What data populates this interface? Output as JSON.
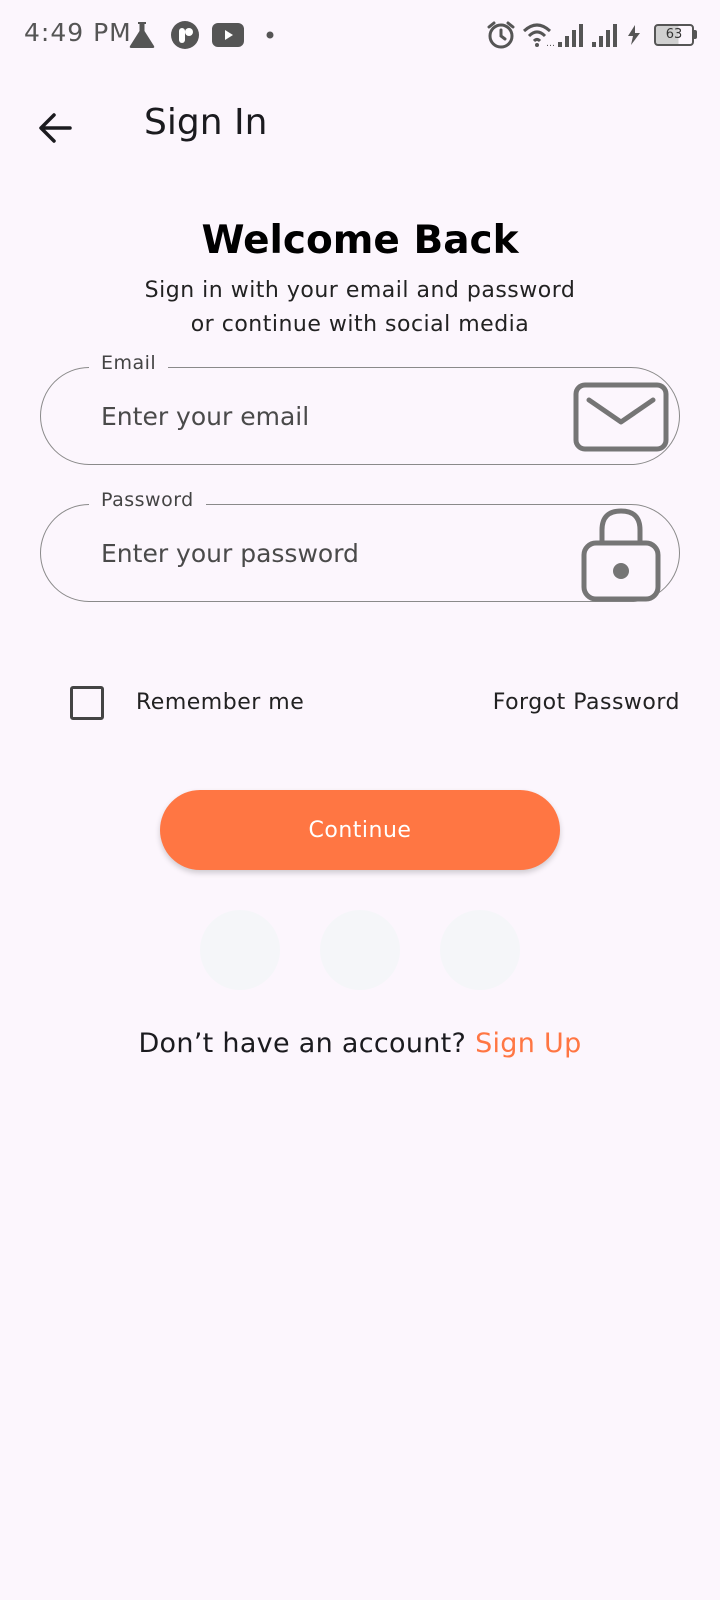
{
  "status_bar": {
    "time": "4:49 PM",
    "battery_level": "63",
    "icons": [
      "flask-icon",
      "app-badge-icon",
      "youtube-icon",
      "dot-icon",
      "alarm-icon",
      "wifi-icon",
      "signal-icon",
      "signal-icon-2",
      "charging-icon",
      "battery-icon"
    ]
  },
  "app_bar": {
    "back_icon": "arrow-left-icon",
    "title": "Sign In"
  },
  "header": {
    "title": "Welcome Back",
    "subtitle_line1": "Sign in with your email and password",
    "subtitle_line2": "or continue with social media"
  },
  "form": {
    "email": {
      "label": "Email",
      "placeholder": "Enter your email",
      "value": "",
      "icon": "mail-icon"
    },
    "password": {
      "label": "Password",
      "placeholder": "Enter your password",
      "value": "",
      "icon": "lock-icon"
    },
    "remember_me": {
      "label": "Remember me",
      "checked": false
    },
    "forgot_password": "Forgot Password",
    "continue_label": "Continue"
  },
  "social_buttons": [
    "social-button-1",
    "social-button-2",
    "social-button-3"
  ],
  "footer": {
    "prompt": "Don’t have an account? ",
    "signup_link": "Sign Up"
  },
  "colors": {
    "background": "#fcf6fd",
    "accent": "#ff7643",
    "social_bg": "#f5f6f9",
    "field_border": "#8a8a8a"
  }
}
